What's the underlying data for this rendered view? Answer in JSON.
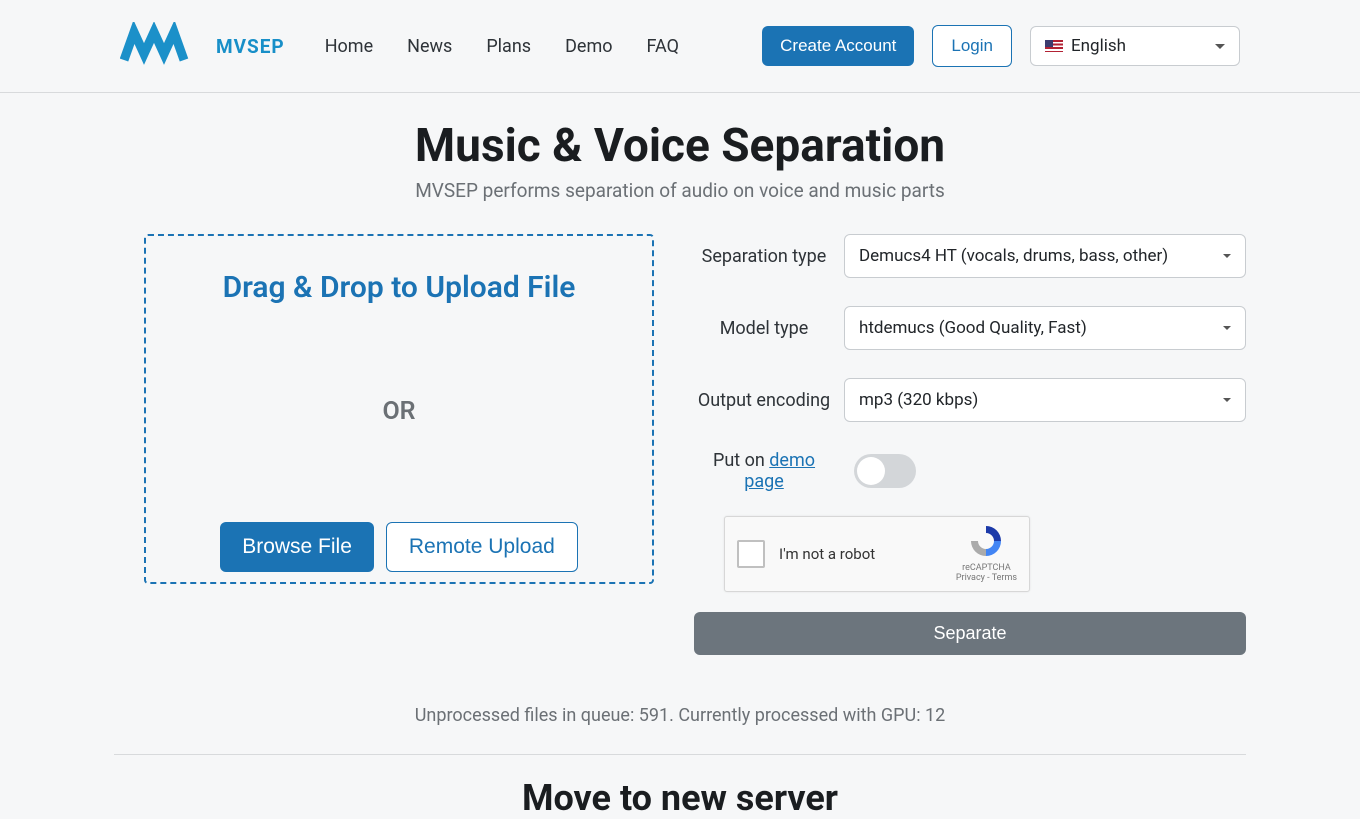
{
  "nav": {
    "links": [
      "Home",
      "News",
      "Plans",
      "Demo",
      "FAQ"
    ],
    "create_account": "Create Account",
    "login": "Login",
    "language": "English"
  },
  "hero": {
    "title": "Music & Voice Separation",
    "subtitle": "MVSEP performs separation of audio on voice and music parts"
  },
  "dropzone": {
    "title": "Drag & Drop to Upload File",
    "or": "OR",
    "browse": "Browse File",
    "remote": "Remote Upload"
  },
  "form": {
    "sep_type_label": "Separation type",
    "sep_type_value": "Demucs4 HT (vocals, drums, bass, other)",
    "model_type_label": "Model type",
    "model_type_value": "htdemucs (Good Quality, Fast)",
    "output_label": "Output encoding",
    "output_value": "mp3 (320 kbps)",
    "demo_label_pre": "Put on ",
    "demo_label_link": "demo page",
    "recaptcha_label": "I'm not a robot",
    "recaptcha_brand": "reCAPTCHA",
    "recaptcha_terms": "Privacy - Terms",
    "separate": "Separate"
  },
  "status": "Unprocessed files in queue: 591. Currently processed with GPU: 12",
  "section2_title": "Move to new server",
  "logo_text": "MVSEP"
}
